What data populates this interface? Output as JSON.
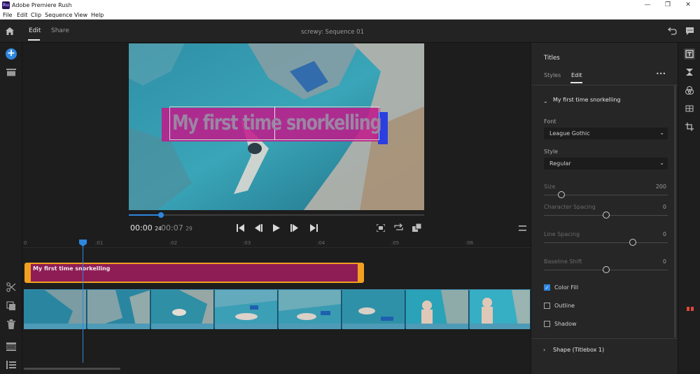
{
  "window": {
    "app_icon_text": "Ru",
    "title": "Adobe Premiere Rush",
    "minimize": "—",
    "restore": "❐",
    "close": "✕"
  },
  "menu": [
    "File",
    "Edit",
    "Clip",
    "Sequence",
    "View",
    "Help"
  ],
  "header": {
    "tabs": [
      "Edit",
      "Share"
    ],
    "active_tab": "Edit",
    "sequence_title": "screwy: Sequence 01"
  },
  "video": {
    "overlay_text": "My first time snorkelling",
    "overlay_color": "#c2188a",
    "scrub_progress": 0.108
  },
  "playback": {
    "current_time": "00:00",
    "current_frames": "24",
    "duration_time": "00:07",
    "duration_frames": "29"
  },
  "timeline": {
    "ticks": [
      "0",
      ":01",
      ":02",
      ":03",
      ":04",
      ":05",
      ":06"
    ],
    "title_clip_label": "My first time snorkelling",
    "title_clip_color": "#8e1d55",
    "title_clip_border": "#f2a020",
    "playhead_color": "#2e86de"
  },
  "panel": {
    "heading": "Titles",
    "tabs": [
      "Styles",
      "Edit"
    ],
    "active_tab": "Edit",
    "more_menu": "•••",
    "section_title": "My first time snorkelling",
    "font_label": "Font",
    "font_value": "League Gothic",
    "style_label": "Style",
    "style_value": "Regular",
    "size_label": "Size",
    "size_value": "200",
    "size_fraction": 0.14,
    "char_spacing_label": "Character Spacing",
    "char_spacing_value": "0",
    "char_spacing_fraction": 0.5,
    "line_spacing_label": "Line Spacing",
    "line_spacing_value": "0",
    "line_spacing_fraction": 0.72,
    "baseline_label": "Baseline Shift",
    "baseline_value": "0",
    "baseline_fraction": 0.5,
    "color_fill_label": "Color Fill",
    "color_fill_checked": true,
    "outline_label": "Outline",
    "outline_checked": false,
    "shadow_label": "Shadow",
    "shadow_checked": false,
    "shape_section": "Shape (Titlebox 1)"
  },
  "accent_color": "#2e86de"
}
